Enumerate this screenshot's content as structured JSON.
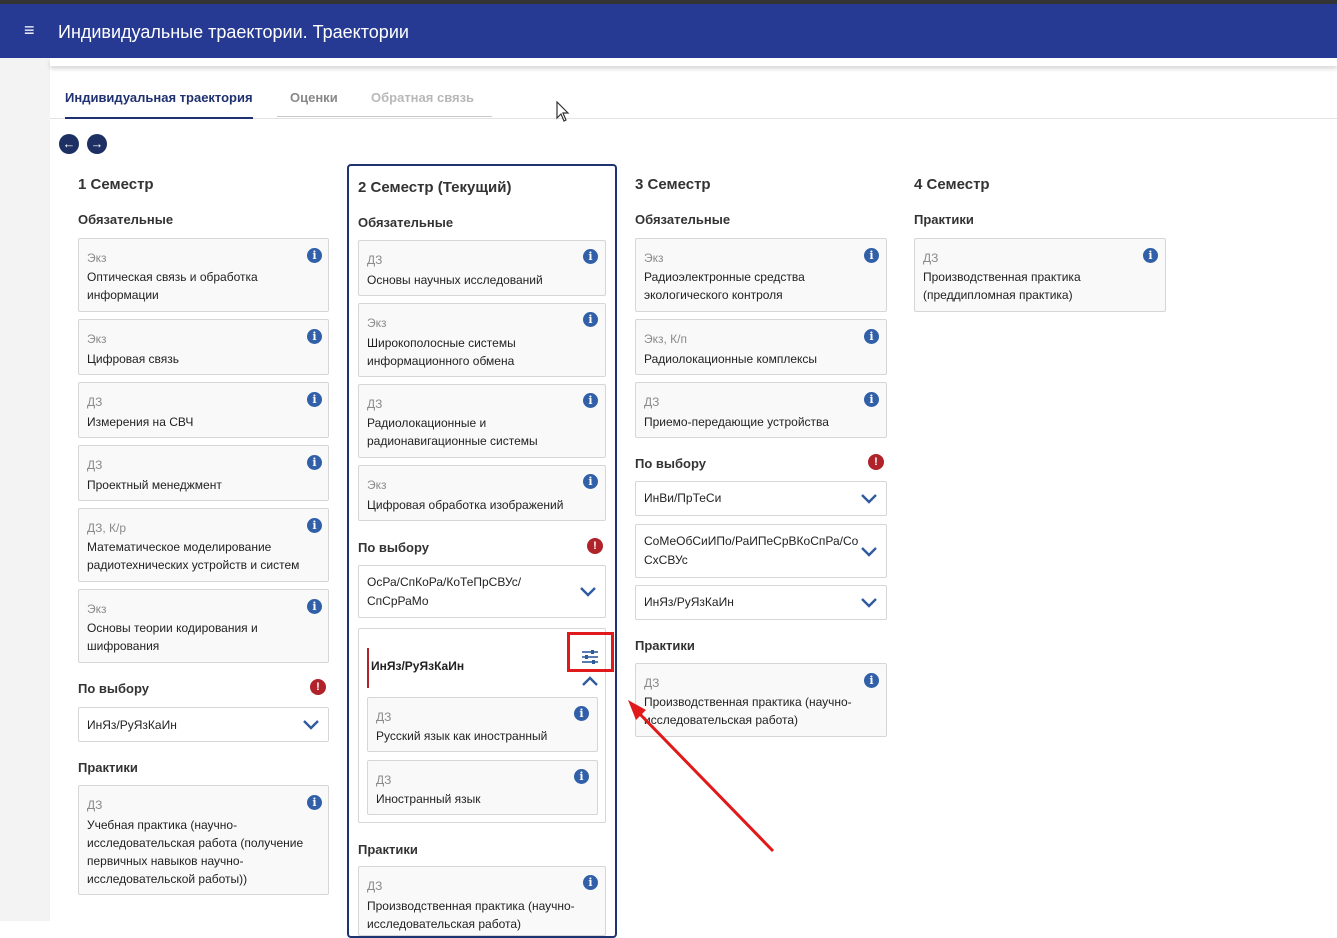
{
  "app": {
    "title": "Индивидуальные траектории. Траектории",
    "menu_icon": "≡"
  },
  "tabs": [
    {
      "label": "Индивидуальная траектория",
      "state": "active"
    },
    {
      "label": "Оценки",
      "state": "normal"
    },
    {
      "label": "Обратная связь",
      "state": "disabled"
    }
  ],
  "nav": {
    "prev_icon": "←",
    "next_icon": "→"
  },
  "icons": {
    "info": "i",
    "warn": "!"
  },
  "colors": {
    "appbar": "#273a93",
    "accent": "#1f3170",
    "info": "#3160a8",
    "warning": "#b0232a",
    "highlight": "#e01a1a"
  },
  "semesters": [
    {
      "title": "1 Семестр",
      "sections": {
        "required": {
          "title": "Обязательные",
          "items": [
            {
              "type": "Экз",
              "name": "Оптическая связь и обработка информации"
            },
            {
              "type": "Экз",
              "name": "Цифровая связь"
            },
            {
              "type": "ДЗ",
              "name": "Измерения на СВЧ"
            },
            {
              "type": "ДЗ",
              "name": "Проектный менеджмент"
            },
            {
              "type": "ДЗ, К/р",
              "name": "Математическое моделирование радиотехнических устройств и систем"
            },
            {
              "type": "Экз",
              "name": "Основы теории кодирования и шифрования"
            }
          ]
        },
        "elective": {
          "title": "По выбору",
          "selects": [
            "ИнЯз/РуЯзКаИн"
          ]
        },
        "practice": {
          "title": "Практики",
          "items": [
            {
              "type": "ДЗ",
              "name": "Учебная практика (научно-исследовательская работа (получение первичных навыков научно-исследовательской работы))"
            }
          ]
        }
      }
    },
    {
      "title": "2 Семестр (Текущий)",
      "sections": {
        "required": {
          "title": "Обязательные",
          "items": [
            {
              "type": "ДЗ",
              "name": "Основы научных исследований"
            },
            {
              "type": "Экз",
              "name": "Широкополосные системы информационного обмена"
            },
            {
              "type": "ДЗ",
              "name": "Радиолокационные и радионавигационные системы"
            },
            {
              "type": "Экз",
              "name": "Цифровая обработка изображений"
            }
          ]
        },
        "elective": {
          "title": "По выбору",
          "selects": [
            "ОсРа/СпКоРа/КоТеПрСВУс/СпСрРаМо"
          ],
          "group": {
            "title": "ИнЯз/РуЯзКаИн",
            "items": [
              {
                "type": "ДЗ",
                "name": "Русский язык как иностранный"
              },
              {
                "type": "ДЗ",
                "name": "Иностранный язык"
              }
            ]
          }
        },
        "practice": {
          "title": "Практики",
          "items": [
            {
              "type": "ДЗ",
              "name": "Производственная практика (научно-исследовательская работа)"
            }
          ]
        }
      }
    },
    {
      "title": "3 Семестр",
      "sections": {
        "required": {
          "title": "Обязательные",
          "items": [
            {
              "type": "Экз",
              "name": "Радиоэлектронные средства экологического контроля"
            },
            {
              "type": "Экз, К/п",
              "name": "Радиолокационные комплексы"
            },
            {
              "type": "ДЗ",
              "name": "Приемо-передающие устройства"
            }
          ]
        },
        "elective": {
          "title": "По выбору",
          "selects": [
            "ИнВи/ПрТеСи",
            "СоМеОбСиИПо/РаИПеСрВКоСпРа/СоСхСВУс",
            "ИнЯз/РуЯзКаИн"
          ]
        },
        "practice": {
          "title": "Практики",
          "items": [
            {
              "type": "ДЗ",
              "name": "Производственная практика (научно-исследовательская работа)"
            }
          ]
        }
      }
    },
    {
      "title": "4 Семестр",
      "sections": {
        "practice": {
          "title": "Практики",
          "items": [
            {
              "type": "ДЗ",
              "name": "Производственная практика (преддипломная практика)"
            }
          ]
        }
      }
    }
  ]
}
